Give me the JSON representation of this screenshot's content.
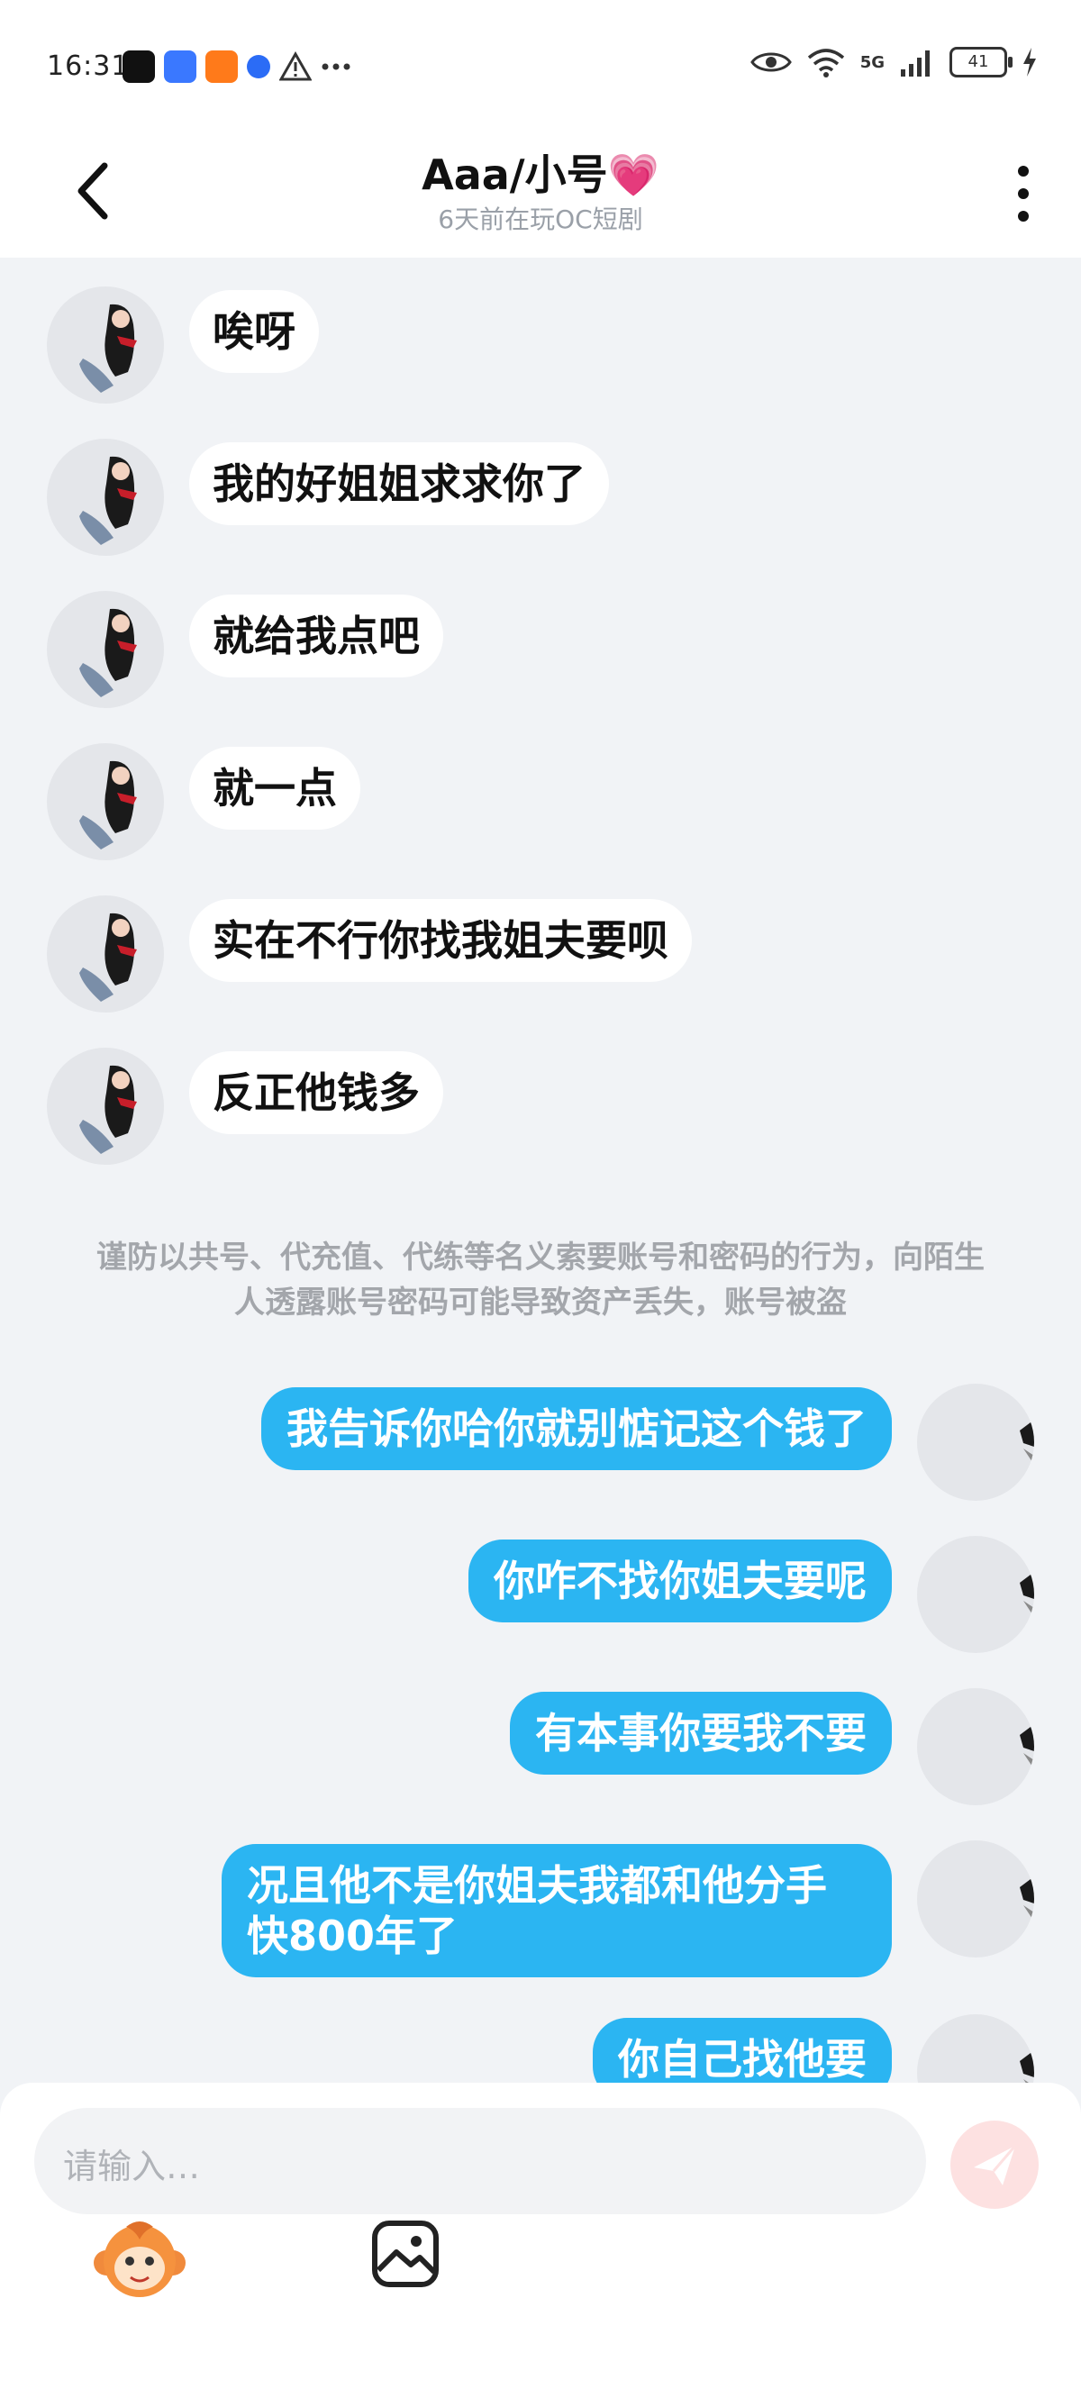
{
  "status_bar": {
    "time": "16:31",
    "network": "5G",
    "battery": "41"
  },
  "header": {
    "title": "Aaa/小号💗",
    "subtitle": "6天前在玩OC短剧"
  },
  "messages_received": [
    "唉呀",
    "我的好姐姐求求你了",
    "就给我点吧",
    "就一点",
    "实在不行你找我姐夫要呗",
    "反正他钱多"
  ],
  "notice": "谨防以共号、代充值、代练等名义索要账号和密码的行为，向陌生人透露账号密码可能导致资产丢失，账号被盗",
  "messages_sent": [
    "我告诉你哈你就别惦记这个钱了",
    "你咋不找你姐夫要呢",
    "有本事你要我不要",
    "况且他不是你姐夫我都和他分手快800年了",
    "你自己找他要"
  ],
  "composer": {
    "placeholder": "请输入…"
  },
  "colors": {
    "sent_bubble": "#2bb5f2",
    "received_bubble": "#ffffff",
    "chat_background": "#f1f3f6",
    "send_button": "#fde1e1"
  },
  "icons": {
    "back": "chevron-left-icon",
    "more": "more-vertical-icon",
    "send": "paper-plane-icon",
    "emoji": "monkey-emoji-icon",
    "image": "image-icon",
    "eye": "eye-icon",
    "wifi": "wifi-icon",
    "signal": "signal-icon",
    "battery": "battery-icon",
    "charging": "bolt-icon"
  }
}
